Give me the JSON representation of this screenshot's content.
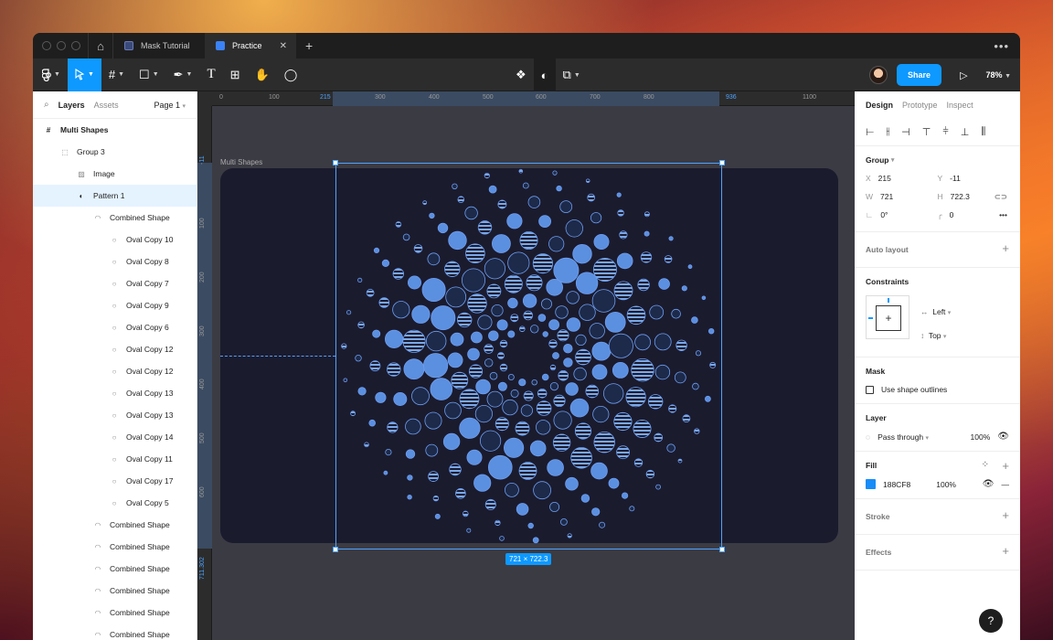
{
  "tabs": [
    {
      "label": "Mask Tutorial"
    },
    {
      "label": "Practice"
    }
  ],
  "toolbar": {
    "share_label": "Share",
    "zoom": "78%"
  },
  "left_panel": {
    "tab_layers": "Layers",
    "tab_assets": "Assets",
    "page_label": "Page 1",
    "layers": [
      {
        "label": "Multi Shapes",
        "icon": "frame-icon"
      },
      {
        "label": "Group 3",
        "icon": "group-icon"
      },
      {
        "label": "Image",
        "icon": "image-icon"
      },
      {
        "label": "Pattern 1",
        "icon": "mask-icon"
      },
      {
        "label": "Combined Shape",
        "icon": "combined-shape-icon"
      },
      {
        "label": "Oval Copy 10",
        "icon": "oval-icon"
      },
      {
        "label": "Oval Copy 8",
        "icon": "oval-icon"
      },
      {
        "label": "Oval Copy 7",
        "icon": "oval-icon"
      },
      {
        "label": "Oval Copy 9",
        "icon": "oval-icon"
      },
      {
        "label": "Oval Copy 6",
        "icon": "oval-icon"
      },
      {
        "label": "Oval Copy 12",
        "icon": "oval-icon"
      },
      {
        "label": "Oval Copy 12",
        "icon": "oval-icon"
      },
      {
        "label": "Oval Copy 13",
        "icon": "oval-icon"
      },
      {
        "label": "Oval Copy 13",
        "icon": "oval-icon"
      },
      {
        "label": "Oval Copy 14",
        "icon": "oval-icon"
      },
      {
        "label": "Oval Copy 11",
        "icon": "oval-icon"
      },
      {
        "label": "Oval Copy 17",
        "icon": "oval-icon"
      },
      {
        "label": "Oval Copy 5",
        "icon": "oval-icon"
      },
      {
        "label": "Combined Shape",
        "icon": "combined-shape-icon"
      },
      {
        "label": "Combined Shape",
        "icon": "combined-shape-icon"
      },
      {
        "label": "Combined Shape",
        "icon": "combined-shape-icon"
      },
      {
        "label": "Combined Shape",
        "icon": "combined-shape-icon"
      },
      {
        "label": "Combined Shape",
        "icon": "combined-shape-icon"
      },
      {
        "label": "Combined Shape",
        "icon": "combined-shape-icon"
      }
    ]
  },
  "ruler": {
    "top": [
      "0",
      "100",
      "215",
      "300",
      "400",
      "500",
      "600",
      "700",
      "800",
      "936",
      "1100"
    ],
    "left": [
      "-11",
      "100",
      "200",
      "300",
      "400",
      "500",
      "600",
      "711.302"
    ]
  },
  "canvas": {
    "frame_label": "Multi Shapes",
    "size_badge": "721 × 722.3",
    "frame_color": "#1b1b2e",
    "accent": "#0d99ff"
  },
  "right_panel": {
    "tab_design": "Design",
    "tab_prototype": "Prototype",
    "tab_inspect": "Inspect",
    "group_title": "Group",
    "x_label": "X",
    "x": "215",
    "y_label": "Y",
    "y": "-11",
    "w_label": "W",
    "w": "721",
    "h_label": "H",
    "h": "722.3",
    "rotation": "0°",
    "radius": "0",
    "auto_layout": "Auto layout",
    "constraints_title": "Constraints",
    "constraint_h": "Left",
    "constraint_v": "Top",
    "mask_title": "Mask",
    "mask_option": "Use shape outlines",
    "layer_title": "Layer",
    "blend": "Pass through",
    "layer_opacity": "100%",
    "fill_title": "Fill",
    "fill_hex": "188CF8",
    "fill_color": "#188cf8",
    "fill_opacity": "100%",
    "stroke_title": "Stroke",
    "effects_title": "Effects"
  },
  "help_label": "?"
}
